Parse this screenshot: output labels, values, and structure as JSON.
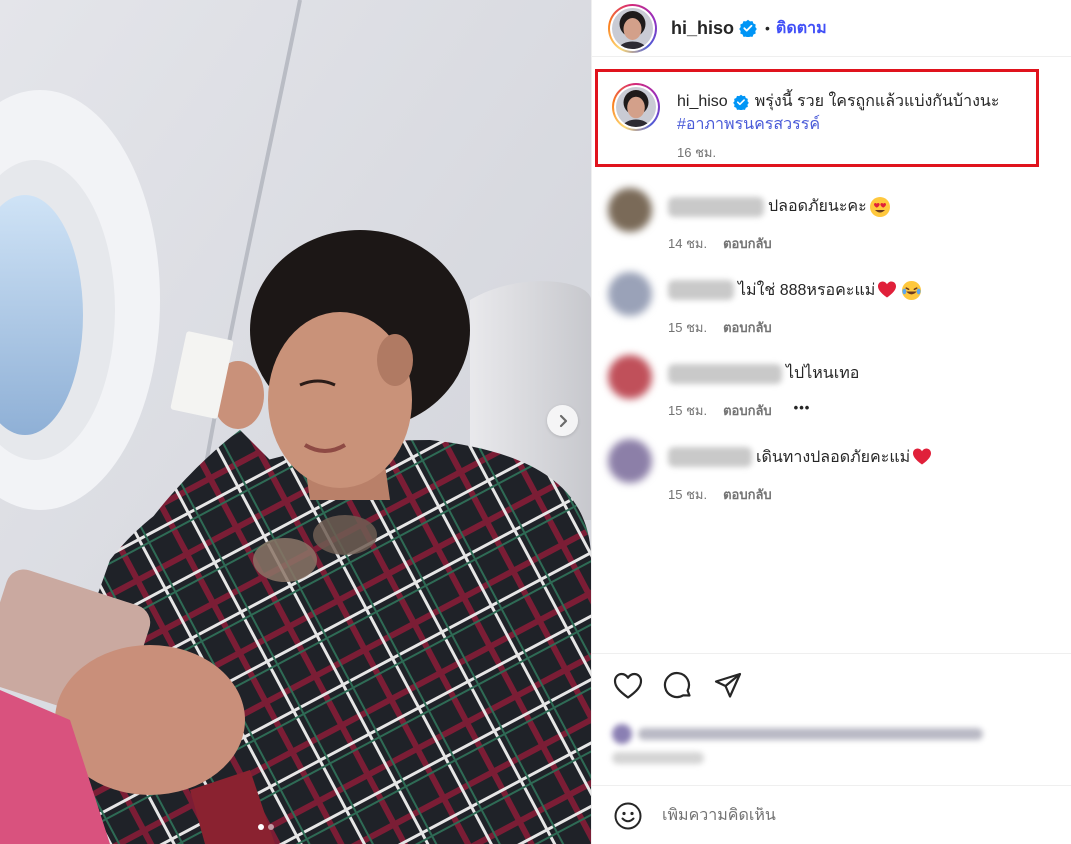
{
  "post": {
    "username": "hi_hiso",
    "follow_label": "ติดตาม",
    "bullet": "•"
  },
  "caption": {
    "username": "hi_hiso",
    "text": "พรุ่งนี้ รวย ใครถูกแล้วแบ่งกันบ้างนะ",
    "hashtag": "#อาภาพรนครสวรรค์",
    "time": "16 ชม."
  },
  "comments": [
    {
      "text": "ปลอดภัยนะคะ",
      "emoji": "heart-eyes-emoji",
      "time": "14 ชม.",
      "reply": "ตอบกลับ",
      "avatar_color": "#7a6a58",
      "has_more": false
    },
    {
      "text": "ไม่ใช่ 888หรอคะแม่",
      "emoji": "red-heart-emoji",
      "emoji2": "laughing-tears-emoji",
      "time": "15 ชม.",
      "reply": "ตอบกลับ",
      "avatar_color": "#9aa2b8",
      "has_more": false
    },
    {
      "text": "ไปไหนเทอ",
      "time": "15 ชม.",
      "reply": "ตอบกลับ",
      "more": "•••",
      "avatar_color": "#c0505a",
      "has_more": true
    },
    {
      "text": "เดินทางปลอดภัยคะแม่",
      "emoji": "red-heart-emoji",
      "time": "15 ชม.",
      "reply": "ตอบกลับ",
      "avatar_color": "#8c7fa8",
      "has_more": false
    }
  ],
  "add_comment": {
    "placeholder": "เพิ่มความคิดเห็น"
  },
  "carousel": {
    "slide": 1,
    "total": 2
  },
  "colors": {
    "follow": "#4150f7",
    "hashtag": "#4a5bd8",
    "highlight_border": "#e0131d",
    "verified": "#0095f6",
    "heart_emoji": "#e0203a"
  }
}
